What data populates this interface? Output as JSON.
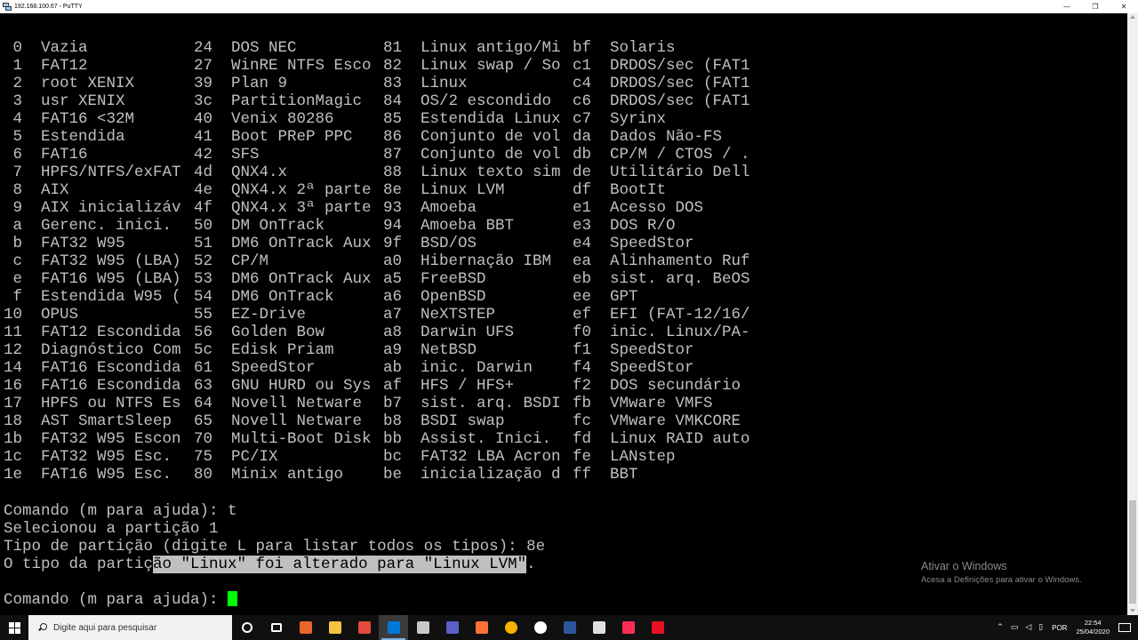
{
  "window": {
    "title": "192.168.100.67 - PuTTY",
    "controls": {
      "minimize": "—",
      "maximize": "❐",
      "close": "✕"
    }
  },
  "partition_table": [
    [
      [
        "0",
        "Vazia"
      ],
      [
        "24",
        "DOS NEC"
      ],
      [
        "81",
        "Linux antigo/Mi"
      ],
      [
        "bf",
        "Solaris"
      ]
    ],
    [
      [
        "1",
        "FAT12"
      ],
      [
        "27",
        "WinRE NTFS Esco"
      ],
      [
        "82",
        "Linux swap / So"
      ],
      [
        "c1",
        "DRDOS/sec (FAT1"
      ]
    ],
    [
      [
        "2",
        "root XENIX"
      ],
      [
        "39",
        "Plan 9"
      ],
      [
        "83",
        "Linux"
      ],
      [
        "c4",
        "DRDOS/sec (FAT1"
      ]
    ],
    [
      [
        "3",
        "usr XENIX"
      ],
      [
        "3c",
        "PartitionMagic"
      ],
      [
        "84",
        "OS/2 escondido"
      ],
      [
        "c6",
        "DRDOS/sec (FAT1"
      ]
    ],
    [
      [
        "4",
        "FAT16 <32M"
      ],
      [
        "40",
        "Venix 80286"
      ],
      [
        "85",
        "Estendida Linux"
      ],
      [
        "c7",
        "Syrinx"
      ]
    ],
    [
      [
        "5",
        "Estendida"
      ],
      [
        "41",
        "Boot PReP PPC"
      ],
      [
        "86",
        "Conjunto de vol"
      ],
      [
        "da",
        "Dados Não-FS"
      ]
    ],
    [
      [
        "6",
        "FAT16"
      ],
      [
        "42",
        "SFS"
      ],
      [
        "87",
        "Conjunto de vol"
      ],
      [
        "db",
        "CP/M / CTOS / ."
      ]
    ],
    [
      [
        "7",
        "HPFS/NTFS/exFAT"
      ],
      [
        "4d",
        "QNX4.x"
      ],
      [
        "88",
        "Linux texto sim"
      ],
      [
        "de",
        "Utilitário Dell"
      ]
    ],
    [
      [
        "8",
        "AIX"
      ],
      [
        "4e",
        "QNX4.x 2ª parte"
      ],
      [
        "8e",
        "Linux LVM"
      ],
      [
        "df",
        "BootIt"
      ]
    ],
    [
      [
        "9",
        "AIX inicializáv"
      ],
      [
        "4f",
        "QNX4.x 3ª parte"
      ],
      [
        "93",
        "Amoeba"
      ],
      [
        "e1",
        "Acesso DOS"
      ]
    ],
    [
      [
        "a",
        "Gerenc. inici."
      ],
      [
        "50",
        "DM OnTrack"
      ],
      [
        "94",
        "Amoeba BBT"
      ],
      [
        "e3",
        "DOS R/O"
      ]
    ],
    [
      [
        "b",
        "FAT32 W95"
      ],
      [
        "51",
        "DM6 OnTrack Aux"
      ],
      [
        "9f",
        "BSD/OS"
      ],
      [
        "e4",
        "SpeedStor"
      ]
    ],
    [
      [
        "c",
        "FAT32 W95 (LBA)"
      ],
      [
        "52",
        "CP/M"
      ],
      [
        "a0",
        "Hibernação IBM"
      ],
      [
        "ea",
        "Alinhamento Ruf"
      ]
    ],
    [
      [
        "e",
        "FAT16 W95 (LBA)"
      ],
      [
        "53",
        "DM6 OnTrack Aux"
      ],
      [
        "a5",
        "FreeBSD"
      ],
      [
        "eb",
        "sist. arq. BeOS"
      ]
    ],
    [
      [
        "f",
        "Estendida W95 ("
      ],
      [
        "54",
        "DM6 OnTrack"
      ],
      [
        "a6",
        "OpenBSD"
      ],
      [
        "ee",
        "GPT"
      ]
    ],
    [
      [
        "10",
        "OPUS"
      ],
      [
        "55",
        "EZ-Drive"
      ],
      [
        "a7",
        "NeXTSTEP"
      ],
      [
        "ef",
        "EFI (FAT-12/16/"
      ]
    ],
    [
      [
        "11",
        "FAT12 Escondida"
      ],
      [
        "56",
        "Golden Bow"
      ],
      [
        "a8",
        "Darwin UFS"
      ],
      [
        "f0",
        "inic. Linux/PA-"
      ]
    ],
    [
      [
        "12",
        "Diagnóstico Com"
      ],
      [
        "5c",
        "Edisk Priam"
      ],
      [
        "a9",
        "NetBSD"
      ],
      [
        "f1",
        "SpeedStor"
      ]
    ],
    [
      [
        "14",
        "FAT16 Escondida"
      ],
      [
        "61",
        "SpeedStor"
      ],
      [
        "ab",
        "inic. Darwin"
      ],
      [
        "f4",
        "SpeedStor"
      ]
    ],
    [
      [
        "16",
        "FAT16 Escondida"
      ],
      [
        "63",
        "GNU HURD ou Sys"
      ],
      [
        "af",
        "HFS / HFS+"
      ],
      [
        "f2",
        "DOS secundário"
      ]
    ],
    [
      [
        "17",
        "HPFS ou NTFS Es"
      ],
      [
        "64",
        "Novell Netware"
      ],
      [
        "b7",
        "sist. arq. BSDI"
      ],
      [
        "fb",
        "VMware VMFS"
      ]
    ],
    [
      [
        "18",
        "AST SmartSleep"
      ],
      [
        "65",
        "Novell Netware"
      ],
      [
        "b8",
        "BSDI swap"
      ],
      [
        "fc",
        "VMware VMKCORE"
      ]
    ],
    [
      [
        "1b",
        "FAT32 W95 Escon"
      ],
      [
        "70",
        "Multi-Boot Disk"
      ],
      [
        "bb",
        "Assist. Inici."
      ],
      [
        "fd",
        "Linux RAID auto"
      ]
    ],
    [
      [
        "1c",
        "FAT32 W95 Esc."
      ],
      [
        "75",
        "PC/IX"
      ],
      [
        "bc",
        "FAT32 LBA Acron"
      ],
      [
        "fe",
        "LANstep"
      ]
    ],
    [
      [
        "1e",
        "FAT16 W95 Esc."
      ],
      [
        "80",
        "Minix antigo"
      ],
      [
        "be",
        "inicialização d"
      ],
      [
        "ff",
        "BBT"
      ]
    ]
  ],
  "console": {
    "line1": "Comando (m para ajuda): t",
    "line2": "Selecionou a partição 1",
    "line3": "Tipo de partição (digite L para listar todos os tipos): 8e",
    "line4_pre": "O tipo da partiç",
    "line4_sel": "ão \"Linux\" foi alterado para \"Linux LVM\"",
    "line4_post": ".",
    "prompt": "Comando (m para ajuda): "
  },
  "watermark": {
    "title": "Ativar o Windows",
    "subtitle": "Acesa a Definições para ativar o Windows."
  },
  "taskbar": {
    "search_placeholder": "Digite aqui para pesquisar",
    "language": "POR",
    "time": "22:54",
    "date": "25/04/2020",
    "tray_caret": "⌃",
    "app_colors": [
      "#e8652c",
      "#f5c242",
      "#e24b3c",
      "#0078d7",
      "#c8c8c8",
      "#5b5fc7",
      "#ff7139",
      "#f4b400",
      "#ffffff",
      "#2b579a",
      "#e0e0e0",
      "#ff2d55",
      "#e81123"
    ]
  }
}
